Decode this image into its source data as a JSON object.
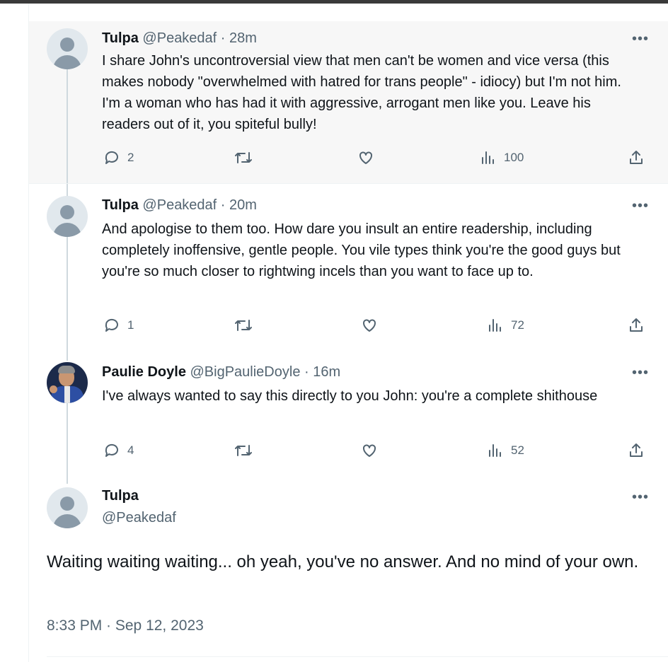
{
  "tweets": [
    {
      "name": "Tulpa",
      "handle": "@Peakedaf",
      "time": "28m",
      "text": "I share John's uncontroversial view that men can't be women and vice versa (this makes nobody \"overwhelmed with hatred for trans people\" - idiocy) but I'm not him. I'm a woman who has had it with aggressive, arrogant men like you. Leave his readers out of it, you spiteful bully!",
      "replies": "2",
      "retweets": "",
      "likes": "",
      "views": "100"
    },
    {
      "name": "Tulpa",
      "handle": "@Peakedaf",
      "time": "20m",
      "text": "And apologise to them too. How dare you insult an entire readership, including completely inoffensive, gentle people. You vile types think you're the good guys but you're so much closer to rightwing incels than you want to face up to.",
      "replies": "1",
      "retweets": "",
      "likes": "",
      "views": "72"
    },
    {
      "name": "Paulie Doyle",
      "handle": "@BigPaulieDoyle",
      "time": "16m",
      "text": "I've always wanted to say this directly to you John: you're a complete shithouse",
      "replies": "4",
      "retweets": "",
      "likes": "",
      "views": "52"
    }
  ],
  "main_tweet": {
    "name": "Tulpa",
    "handle": "@Peakedaf",
    "text": "Waiting waiting waiting... oh yeah, you've no answer. And no mind of your own.",
    "timestamp": "8:33 PM · Sep 12, 2023"
  },
  "separator": " · ",
  "more_glyph": "•••",
  "icons": {
    "reply": "reply-icon",
    "retweet": "retweet-icon",
    "like": "heart-icon",
    "views": "views-icon",
    "share": "share-icon",
    "more": "more-icon",
    "avatar_default": "default-avatar-icon"
  },
  "colors": {
    "text": "#0f1419",
    "muted": "#536471",
    "thread_line": "#cfd9de",
    "highlight_bg": "#f7f7f7"
  }
}
